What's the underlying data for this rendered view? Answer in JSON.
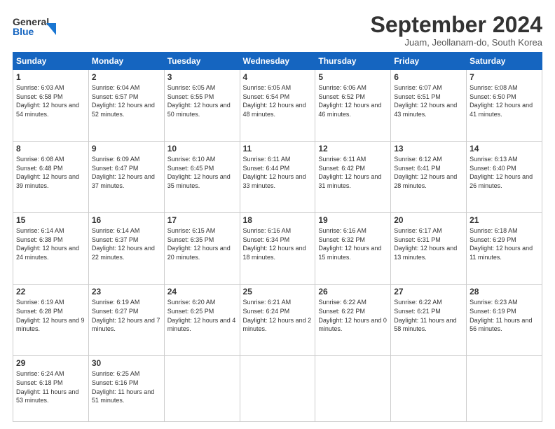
{
  "header": {
    "logo_line1": "General",
    "logo_line2": "Blue",
    "month_title": "September 2024",
    "subtitle": "Juam, Jeollanam-do, South Korea"
  },
  "days_of_week": [
    "Sunday",
    "Monday",
    "Tuesday",
    "Wednesday",
    "Thursday",
    "Friday",
    "Saturday"
  ],
  "weeks": [
    [
      {
        "day": "1",
        "sunrise": "6:03 AM",
        "sunset": "6:58 PM",
        "daylight": "12 hours and 54 minutes."
      },
      {
        "day": "2",
        "sunrise": "6:04 AM",
        "sunset": "6:57 PM",
        "daylight": "12 hours and 52 minutes."
      },
      {
        "day": "3",
        "sunrise": "6:05 AM",
        "sunset": "6:55 PM",
        "daylight": "12 hours and 50 minutes."
      },
      {
        "day": "4",
        "sunrise": "6:05 AM",
        "sunset": "6:54 PM",
        "daylight": "12 hours and 48 minutes."
      },
      {
        "day": "5",
        "sunrise": "6:06 AM",
        "sunset": "6:52 PM",
        "daylight": "12 hours and 46 minutes."
      },
      {
        "day": "6",
        "sunrise": "6:07 AM",
        "sunset": "6:51 PM",
        "daylight": "12 hours and 43 minutes."
      },
      {
        "day": "7",
        "sunrise": "6:08 AM",
        "sunset": "6:50 PM",
        "daylight": "12 hours and 41 minutes."
      }
    ],
    [
      {
        "day": "8",
        "sunrise": "6:08 AM",
        "sunset": "6:48 PM",
        "daylight": "12 hours and 39 minutes."
      },
      {
        "day": "9",
        "sunrise": "6:09 AM",
        "sunset": "6:47 PM",
        "daylight": "12 hours and 37 minutes."
      },
      {
        "day": "10",
        "sunrise": "6:10 AM",
        "sunset": "6:45 PM",
        "daylight": "12 hours and 35 minutes."
      },
      {
        "day": "11",
        "sunrise": "6:11 AM",
        "sunset": "6:44 PM",
        "daylight": "12 hours and 33 minutes."
      },
      {
        "day": "12",
        "sunrise": "6:11 AM",
        "sunset": "6:42 PM",
        "daylight": "12 hours and 31 minutes."
      },
      {
        "day": "13",
        "sunrise": "6:12 AM",
        "sunset": "6:41 PM",
        "daylight": "12 hours and 28 minutes."
      },
      {
        "day": "14",
        "sunrise": "6:13 AM",
        "sunset": "6:40 PM",
        "daylight": "12 hours and 26 minutes."
      }
    ],
    [
      {
        "day": "15",
        "sunrise": "6:14 AM",
        "sunset": "6:38 PM",
        "daylight": "12 hours and 24 minutes."
      },
      {
        "day": "16",
        "sunrise": "6:14 AM",
        "sunset": "6:37 PM",
        "daylight": "12 hours and 22 minutes."
      },
      {
        "day": "17",
        "sunrise": "6:15 AM",
        "sunset": "6:35 PM",
        "daylight": "12 hours and 20 minutes."
      },
      {
        "day": "18",
        "sunrise": "6:16 AM",
        "sunset": "6:34 PM",
        "daylight": "12 hours and 18 minutes."
      },
      {
        "day": "19",
        "sunrise": "6:16 AM",
        "sunset": "6:32 PM",
        "daylight": "12 hours and 15 minutes."
      },
      {
        "day": "20",
        "sunrise": "6:17 AM",
        "sunset": "6:31 PM",
        "daylight": "12 hours and 13 minutes."
      },
      {
        "day": "21",
        "sunrise": "6:18 AM",
        "sunset": "6:29 PM",
        "daylight": "12 hours and 11 minutes."
      }
    ],
    [
      {
        "day": "22",
        "sunrise": "6:19 AM",
        "sunset": "6:28 PM",
        "daylight": "12 hours and 9 minutes."
      },
      {
        "day": "23",
        "sunrise": "6:19 AM",
        "sunset": "6:27 PM",
        "daylight": "12 hours and 7 minutes."
      },
      {
        "day": "24",
        "sunrise": "6:20 AM",
        "sunset": "6:25 PM",
        "daylight": "12 hours and 4 minutes."
      },
      {
        "day": "25",
        "sunrise": "6:21 AM",
        "sunset": "6:24 PM",
        "daylight": "12 hours and 2 minutes."
      },
      {
        "day": "26",
        "sunrise": "6:22 AM",
        "sunset": "6:22 PM",
        "daylight": "12 hours and 0 minutes."
      },
      {
        "day": "27",
        "sunrise": "6:22 AM",
        "sunset": "6:21 PM",
        "daylight": "11 hours and 58 minutes."
      },
      {
        "day": "28",
        "sunrise": "6:23 AM",
        "sunset": "6:19 PM",
        "daylight": "11 hours and 56 minutes."
      }
    ],
    [
      {
        "day": "29",
        "sunrise": "6:24 AM",
        "sunset": "6:18 PM",
        "daylight": "11 hours and 53 minutes."
      },
      {
        "day": "30",
        "sunrise": "6:25 AM",
        "sunset": "6:16 PM",
        "daylight": "11 hours and 51 minutes."
      },
      null,
      null,
      null,
      null,
      null
    ]
  ]
}
